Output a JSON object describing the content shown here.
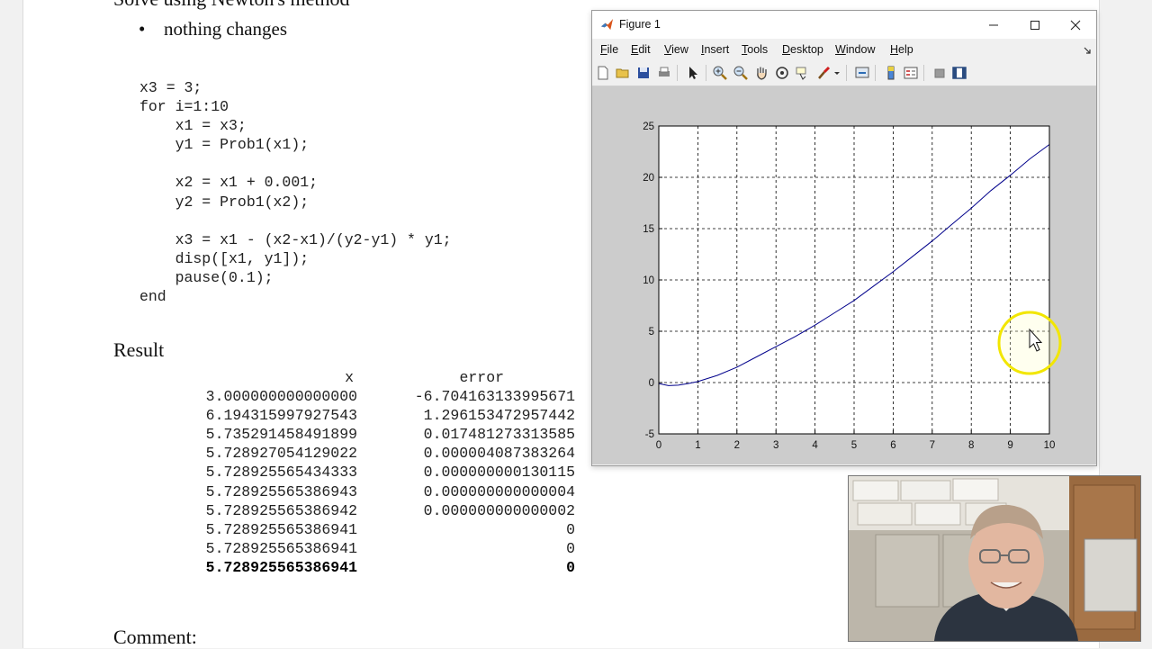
{
  "document": {
    "section_title": "Solve using Newton's method",
    "bullet": "nothing changes",
    "code_lines": [
      "x3 = 3;",
      "for i=1:10",
      "    x1 = x3;",
      "    y1 = Prob1(x1);",
      "",
      "    x2 = x1 + 0.001;",
      "    y2 = Prob1(x2);",
      "",
      "    x3 = x1 - (x2-x1)/(y2-y1) * y1;",
      "    disp([x1, y1]);",
      "    pause(0.1);",
      "end"
    ],
    "result_title": "Result",
    "result_headers": {
      "x": "x",
      "error": "error"
    },
    "result_rows": [
      {
        "x": "3.000000000000000",
        "error": "-6.704163133995671"
      },
      {
        "x": "6.194315997927543",
        "error": "1.296153472957442"
      },
      {
        "x": "5.735291458491899",
        "error": "0.017481273313585"
      },
      {
        "x": "5.728927054129022",
        "error": "0.000004087383264"
      },
      {
        "x": "5.728925565434333",
        "error": "0.000000000130115"
      },
      {
        "x": "5.728925565386943",
        "error": "0.000000000000004"
      },
      {
        "x": "5.728925565386942",
        "error": "0.000000000000002"
      },
      {
        "x": "5.728925565386941",
        "error": "0"
      },
      {
        "x": "5.728925565386941",
        "error": "0"
      },
      {
        "x": "5.728925565386941",
        "error": "0",
        "bold": true
      }
    ],
    "comment_title": "Comment:"
  },
  "figure_window": {
    "title": "Figure 1",
    "menu": [
      "File",
      "Edit",
      "View",
      "Insert",
      "Tools",
      "Desktop",
      "Window",
      "Help"
    ],
    "toolbar_icons": [
      "new-figure-icon",
      "open-file-icon",
      "save-figure-icon",
      "print-figure-icon",
      "edit-plot-arrow-icon",
      "zoom-in-icon",
      "zoom-out-icon",
      "pan-hand-icon",
      "rotate-3d-icon",
      "data-cursor-icon",
      "brush-icon",
      "brush-dropdown-icon",
      "link-plot-icon",
      "insert-colorbar-icon",
      "insert-legend-icon",
      "hide-plot-tools-icon",
      "show-plot-tools-icon"
    ]
  },
  "chart_data": {
    "type": "line",
    "title": "",
    "xlabel": "",
    "ylabel": "",
    "xlim": [
      0,
      10
    ],
    "ylim": [
      -5,
      25
    ],
    "xticks": [
      0,
      1,
      2,
      3,
      4,
      5,
      6,
      7,
      8,
      9,
      10
    ],
    "yticks": [
      -5,
      0,
      5,
      10,
      15,
      20,
      25
    ],
    "grid": true,
    "series": [
      {
        "color": "#00008b",
        "x": [
          0,
          0.25,
          0.5,
          0.75,
          1,
          1.5,
          2,
          2.5,
          3,
          3.5,
          4,
          4.5,
          5,
          5.5,
          6,
          6.5,
          7,
          7.5,
          8,
          8.5,
          9,
          9.5,
          10
        ],
        "y": [
          -0.1,
          -0.3,
          -0.25,
          -0.1,
          0.1,
          0.7,
          1.5,
          2.5,
          3.5,
          4.5,
          5.6,
          6.8,
          8.0,
          9.4,
          10.8,
          12.3,
          13.8,
          15.4,
          17.0,
          18.7,
          20.2,
          21.8,
          23.2
        ]
      }
    ]
  },
  "overlays": {
    "cursor_highlight_color": "#f2e600",
    "webcam": "presenter-webcam-feed"
  }
}
